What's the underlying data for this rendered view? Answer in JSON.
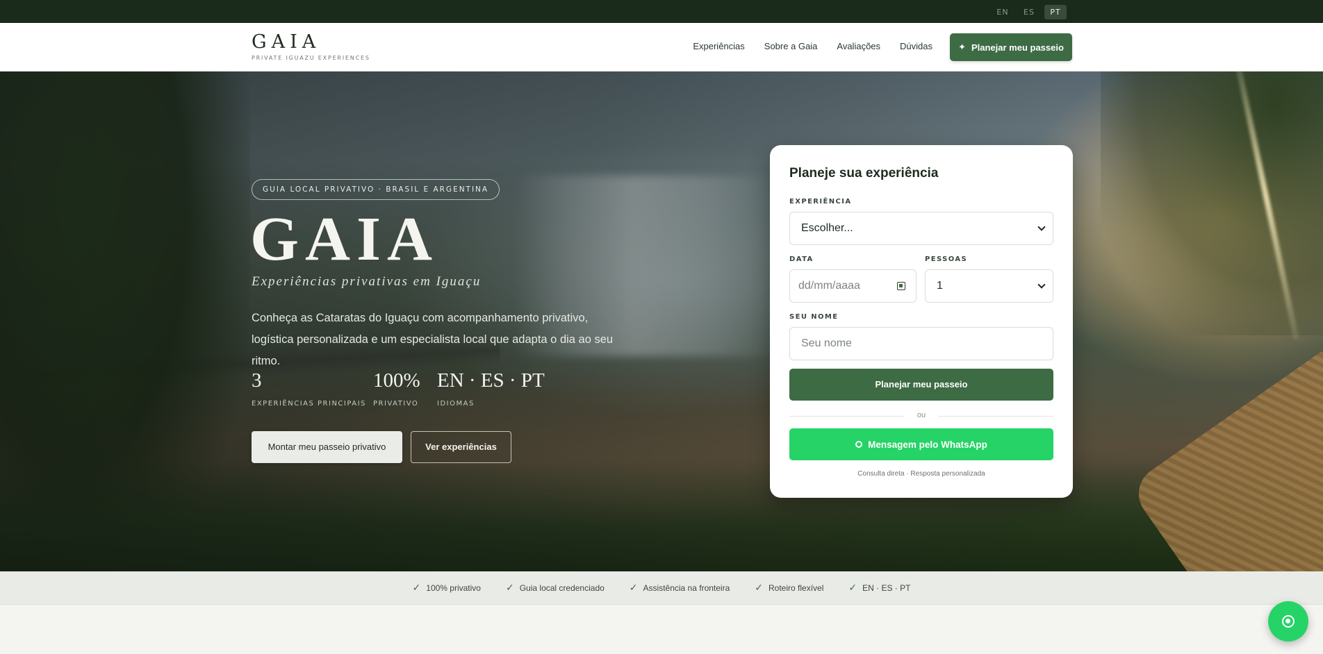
{
  "languages": [
    {
      "code": "EN",
      "active": false
    },
    {
      "code": "ES",
      "active": false
    },
    {
      "code": "PT",
      "active": true
    }
  ],
  "brand": {
    "name": "GAIA",
    "tagline": "PRIVATE IGUAZU EXPERIENCES"
  },
  "nav": {
    "items": [
      "Experiências",
      "Sobre a Gaia",
      "Avaliações",
      "Dúvidas"
    ],
    "cta_icon": "✦",
    "cta_label": "Planejar meu passeio"
  },
  "hero": {
    "badge": "GUIA LOCAL PRIVATIVO · BRASIL E ARGENTINA",
    "title": "GAIA",
    "subtitle": "Experiências privativas em Iguaçu",
    "description": "Conheça as Cataratas do Iguaçu com acompanhamento privativo, logística personalizada e um especialista local que adapta o dia ao seu ritmo.",
    "stats": [
      {
        "value": "3",
        "label": "EXPERIÊNCIAS PRINCIPAIS"
      },
      {
        "value": "100%",
        "label": "PRIVATIVO"
      },
      {
        "value": "EN · ES · PT",
        "label": "IDIOMAS"
      }
    ],
    "primary_button": "Montar meu passeio privativo",
    "secondary_button": "Ver experiências"
  },
  "booking": {
    "title": "Planeje sua experiência",
    "experience_label": "EXPERIÊNCIA",
    "experience_value": "Escolher...",
    "date_label": "DATA",
    "date_placeholder": "dd/mm/aaaa",
    "people_label": "PESSOAS",
    "people_value": "1",
    "name_label": "SEU NOME",
    "name_placeholder": "Seu nome",
    "submit_label": "Planejar meu passeio",
    "or_text": "ou",
    "whatsapp_label": "Mensagem pelo WhatsApp",
    "note": "Consulta direta · Resposta personalizada"
  },
  "trust": [
    "100% privativo",
    "Guia local credenciado",
    "Assistência na fronteira",
    "Roteiro flexível",
    "EN · ES · PT"
  ],
  "colors": {
    "brand_green": "#3d6b44",
    "dark_green": "#1a2b1b",
    "whatsapp_green": "#25d366"
  },
  "icons": {
    "check": "✓",
    "calendar": "calendar-icon",
    "whatsapp": "whatsapp-icon"
  }
}
